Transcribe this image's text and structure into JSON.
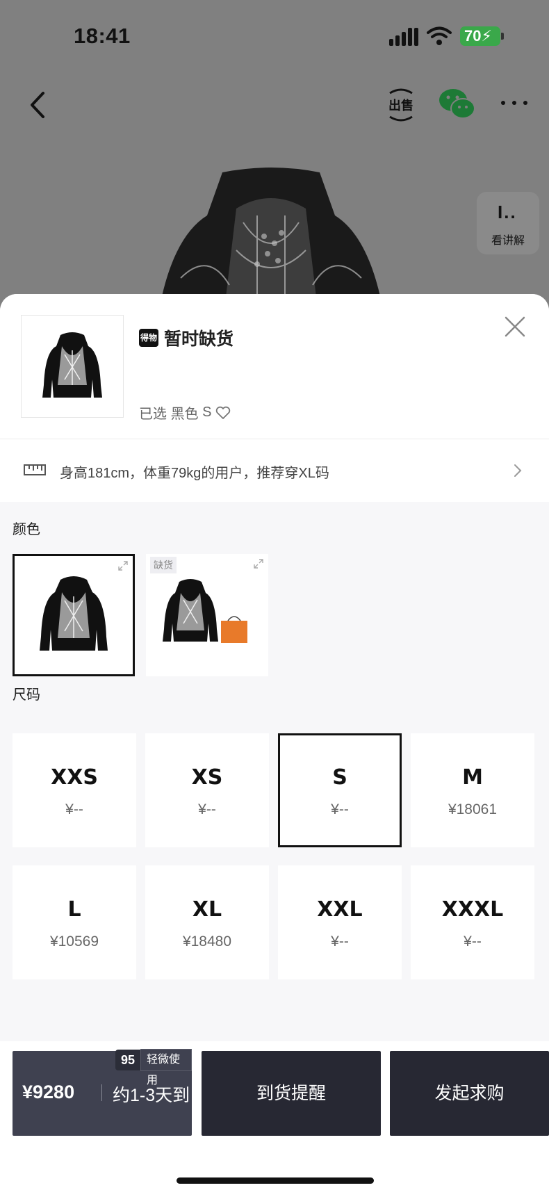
{
  "status_bar": {
    "time": "18:41",
    "battery": "70"
  },
  "nav": {
    "sell_label": "出售"
  },
  "explain": {
    "icon_text": "I..",
    "label": "看讲解"
  },
  "sheet": {
    "stock_brand_logo": "得物",
    "stock_status": "暂时缺货",
    "selected_prefix": "已选",
    "selected_color": "黑色",
    "selected_size": "S",
    "recommend_text": "身高181cm，体重79kg的用户，推荐穿XL码",
    "color_section_label": "颜色",
    "colors": [
      {
        "selected": true,
        "tag": ""
      },
      {
        "selected": false,
        "tag": "缺货"
      }
    ],
    "size_section_label": "尺码",
    "sizes": [
      {
        "name": "XXS",
        "price": "¥--"
      },
      {
        "name": "XS",
        "price": "¥--"
      },
      {
        "name": "S",
        "price": "¥--"
      },
      {
        "name": "M",
        "price": "¥18061"
      },
      {
        "name": "L",
        "price": "¥10569"
      },
      {
        "name": "XL",
        "price": "¥18480"
      },
      {
        "name": "XXL",
        "price": "¥--"
      },
      {
        "name": "XXXL",
        "price": "¥--"
      }
    ],
    "selected_size_index": 2
  },
  "bottom_bar": {
    "buy_price": "¥9280",
    "buy_eta": "约1-3天到",
    "condition_score": "95",
    "condition_text": "轻微使用",
    "notify_label": "到货提醒",
    "request_label": "发起求购"
  },
  "colors": {
    "accent_dark": "#272833",
    "buy_button": "#3f4150",
    "battery_green": "#3aa84a"
  }
}
